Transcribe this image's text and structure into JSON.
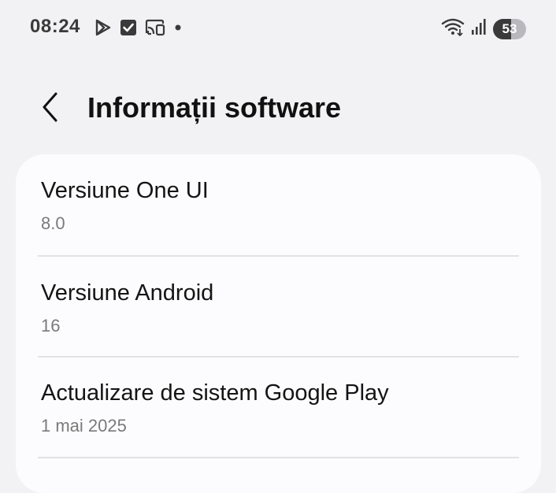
{
  "status_bar": {
    "time": "08:24",
    "battery_level": "53",
    "left_icons": [
      "play-store-icon",
      "checkbox-notification-icon",
      "cast-icon",
      "dot-icon"
    ],
    "right_icons": [
      "wifi-icon",
      "signal-icon",
      "battery-icon"
    ]
  },
  "header": {
    "back_icon": "chevron-left-icon",
    "title": "Informații software"
  },
  "list": {
    "items": [
      {
        "title": "Versiune One UI",
        "value": "8.0"
      },
      {
        "title": "Versiune Android",
        "value": "16"
      },
      {
        "title": "Actualizare de sistem Google Play",
        "value": "1 mai 2025"
      }
    ]
  }
}
